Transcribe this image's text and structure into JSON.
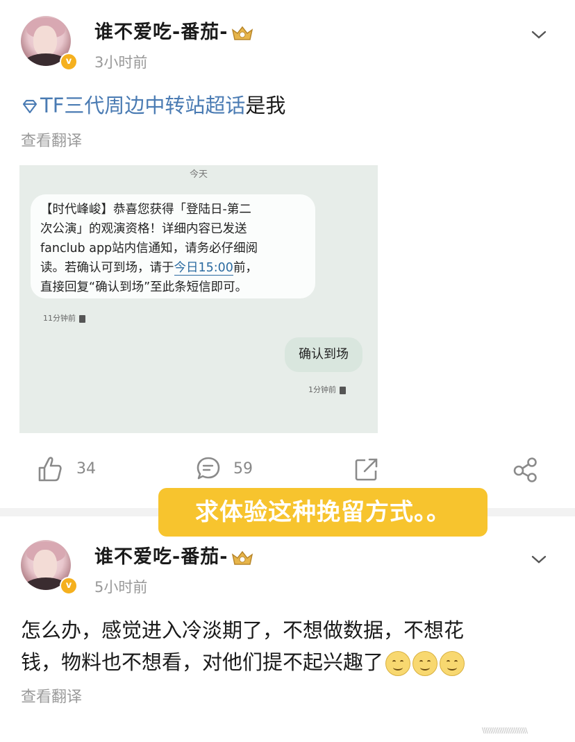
{
  "post1": {
    "username": "谁不爱吃-番茄-",
    "time": "3小时前",
    "topic": "TF三代周边中转站超话",
    "text_tail": "是我",
    "translate": "查看翻译",
    "screenshot": {
      "date_label": "今天",
      "incoming_message_lines": [
        "【时代峰峻】恭喜您获得「登陆日-第二",
        "次公演」的观演资格！详细内容已发送",
        "fanclub app站内信通知，请务必仔细阅",
        "读。若确认可到场，请于"
      ],
      "incoming_link": "今日15:00",
      "incoming_after_link": "前，",
      "incoming_last_line": "直接回复“确认到场”至此条短信即可。",
      "incoming_time": "11分钟前",
      "outgoing_message": "确认到场",
      "outgoing_time": "1分钟前"
    },
    "actions": {
      "likes": "34",
      "comments": "59"
    }
  },
  "banner": "求体验这种挽留方式。。",
  "post2": {
    "username": "谁不爱吃-番茄-",
    "time": "5小时前",
    "text_line1": "怎么办，感觉进入冷淡期了，不想做数据，不想花",
    "text_line2": "钱，物料也不想看，对他们提不起兴趣了",
    "emoji_icon": "smile-emoji-icon",
    "translate": "查看翻译"
  },
  "watermark": "\\\\\\\\\\\\\\\\\\\\\\\\\\\\\\\\\\\\\\\\\\\\\\\\",
  "colors": {
    "topic": "#4a7bb3",
    "banner_bg": "#f7c42e",
    "vip_badge": "#f5b01e"
  }
}
